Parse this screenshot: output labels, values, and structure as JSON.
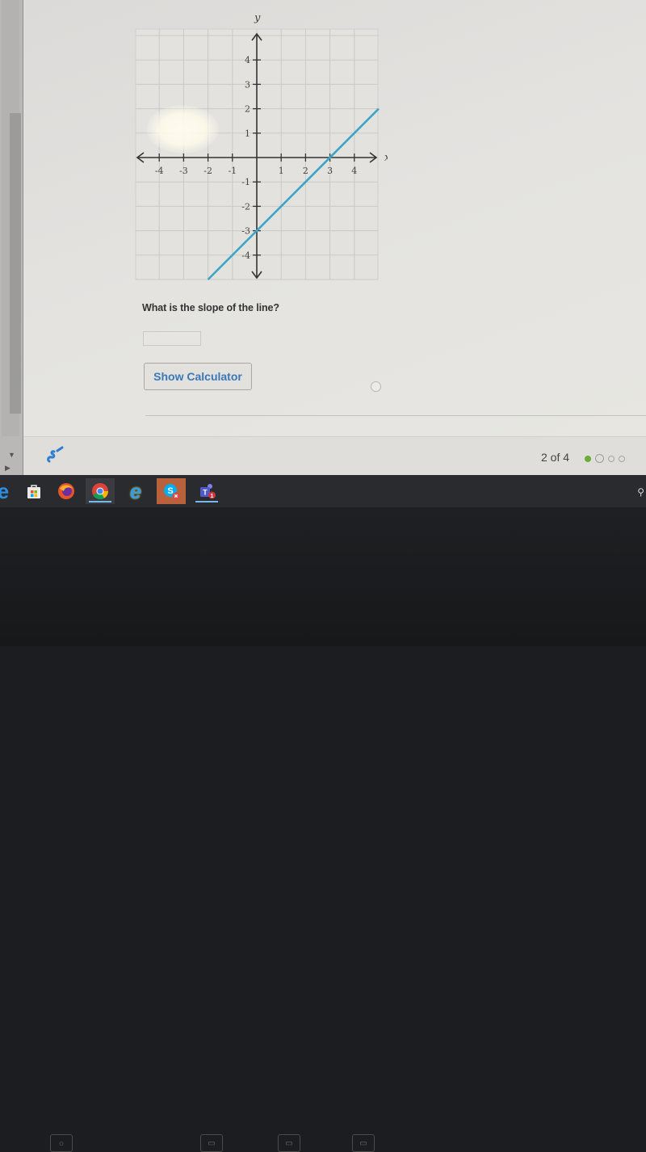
{
  "graph": {
    "x_axis_label": "x",
    "y_axis_label": "y",
    "x_ticks": [
      "-4",
      "-3",
      "-2",
      "-1",
      "1",
      "2",
      "3",
      "4"
    ],
    "y_ticks": [
      "4",
      "3",
      "2",
      "1",
      "-1",
      "-2",
      "-3",
      "-4"
    ],
    "line_color": "#3aa6c4"
  },
  "chart_data": {
    "type": "line",
    "title": "",
    "xlabel": "x",
    "ylabel": "y",
    "xlim": [
      -5,
      5
    ],
    "ylim": [
      -5,
      5
    ],
    "grid": true,
    "x_tick_values": [
      -4,
      -3,
      -2,
      -1,
      1,
      2,
      3,
      4
    ],
    "y_tick_values": [
      -4,
      -3,
      -2,
      -1,
      1,
      2,
      3,
      4
    ],
    "series": [
      {
        "name": "line",
        "equation": "y = x - 3",
        "slope": 1,
        "intercept": -3,
        "x": [
          -2,
          5
        ],
        "y": [
          -5,
          2
        ],
        "color": "#3aa6c4"
      }
    ]
  },
  "question": {
    "text": "What is the slope of the line?",
    "answer_value": "",
    "answer_placeholder": ""
  },
  "buttons": {
    "show_calculator": "Show Calculator"
  },
  "footer": {
    "page_indicator": "2 of 4",
    "current_page": 2,
    "total_pages": 4,
    "progress_dot_colors": {
      "completed": "#6aab3a",
      "pending": "#a6a6a6"
    }
  },
  "taskbar": {
    "apps": [
      {
        "name": "Edge (partial)",
        "icon": "edge-icon"
      },
      {
        "name": "Microsoft Store",
        "icon": "store-icon"
      },
      {
        "name": "Firefox",
        "icon": "firefox-icon"
      },
      {
        "name": "Google Chrome",
        "icon": "chrome-icon",
        "active": true
      },
      {
        "name": "Internet Explorer",
        "icon": "ie-icon"
      },
      {
        "name": "Skype",
        "icon": "skype-icon",
        "badge": "error"
      },
      {
        "name": "Microsoft Teams",
        "icon": "teams-icon",
        "badge": "1",
        "active": true
      }
    ],
    "tray_icon": "people-icon"
  }
}
